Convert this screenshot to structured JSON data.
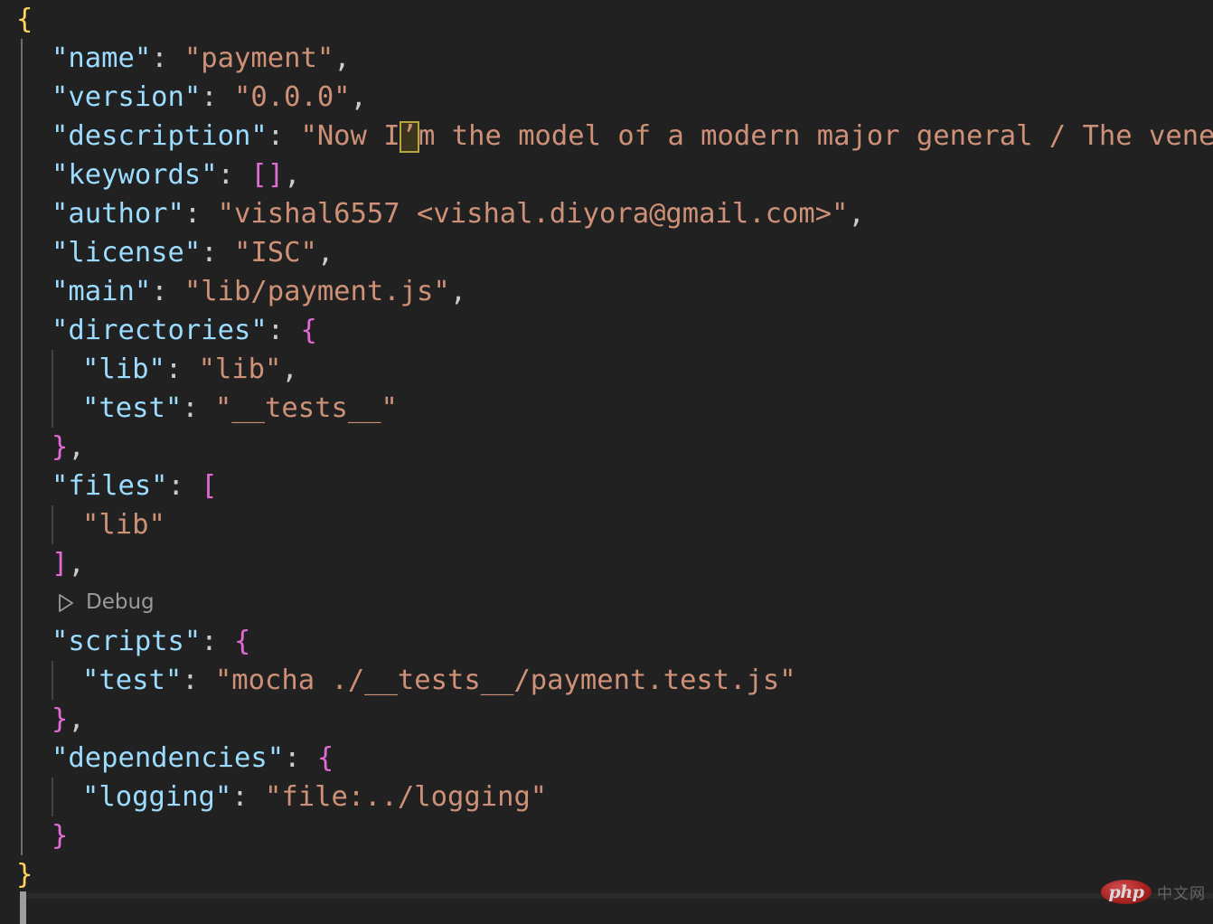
{
  "editor": {
    "background": "#212121",
    "file_language": "json",
    "colors": {
      "property_key": "#9cdcfe",
      "string_value": "#ce9178",
      "bracket_level_1": "#ffd45e",
      "bracket_level_2": "#e36ad4",
      "punctuation": "#cccccc",
      "codelens": "#9a9a9a",
      "unicode_highlight_border": "#b5a642",
      "indent_guide_active": "#6e6e6e",
      "indent_guide": "#434343"
    }
  },
  "code": {
    "line01": {
      "brace": "{"
    },
    "line02": {
      "key": "\"name\"",
      "colon": ": ",
      "value": "\"payment\"",
      "comma": ","
    },
    "line03": {
      "key": "\"version\"",
      "colon": ": ",
      "value": "\"0.0.0\"",
      "comma": ","
    },
    "line04": {
      "key": "\"description\"",
      "colon": ": ",
      "value_before": "\"Now I",
      "value_highlighted": "’",
      "value_after": "m the model of a modern major general / The venerate",
      "clipped": true
    },
    "line05": {
      "key": "\"keywords\"",
      "colon": ": ",
      "bracket_open": "[",
      "bracket_close": "]",
      "comma": ","
    },
    "line06": {
      "key": "\"author\"",
      "colon": ": ",
      "value": "\"vishal6557 <vishal.diyora@gmail.com>\"",
      "comma": ","
    },
    "line07": {
      "key": "\"license\"",
      "colon": ": ",
      "value": "\"ISC\"",
      "comma": ","
    },
    "line08": {
      "key": "\"main\"",
      "colon": ": ",
      "value": "\"lib/payment.js\"",
      "comma": ","
    },
    "line09": {
      "key": "\"directories\"",
      "colon": ": ",
      "brace": "{"
    },
    "line10": {
      "key": "\"lib\"",
      "colon": ": ",
      "value": "\"lib\"",
      "comma": ","
    },
    "line11": {
      "key": "\"test\"",
      "colon": ": ",
      "value": "\"__tests__\""
    },
    "line12": {
      "brace": "}",
      "comma": ","
    },
    "line13": {
      "key": "\"files\"",
      "colon": ": ",
      "bracket": "["
    },
    "line14": {
      "value": "\"lib\""
    },
    "line15": {
      "bracket": "]",
      "comma": ","
    },
    "line16": {
      "codelens_label": "Debug",
      "codelens_icon": "play-triangle-icon"
    },
    "line17": {
      "key": "\"scripts\"",
      "colon": ": ",
      "brace": "{"
    },
    "line18": {
      "key": "\"test\"",
      "colon": ": ",
      "value": "\"mocha ./__tests__/payment.test.js\""
    },
    "line19": {
      "brace": "}",
      "comma": ","
    },
    "line20": {
      "key": "\"dependencies\"",
      "colon": ": ",
      "brace": "{"
    },
    "line21": {
      "key": "\"logging\"",
      "colon": ": ",
      "value": "\"file:../logging\""
    },
    "line22": {
      "brace": "}"
    },
    "line23": {
      "brace": "}"
    }
  },
  "watermark": {
    "logo_text": "php",
    "site_text": "中文网"
  }
}
